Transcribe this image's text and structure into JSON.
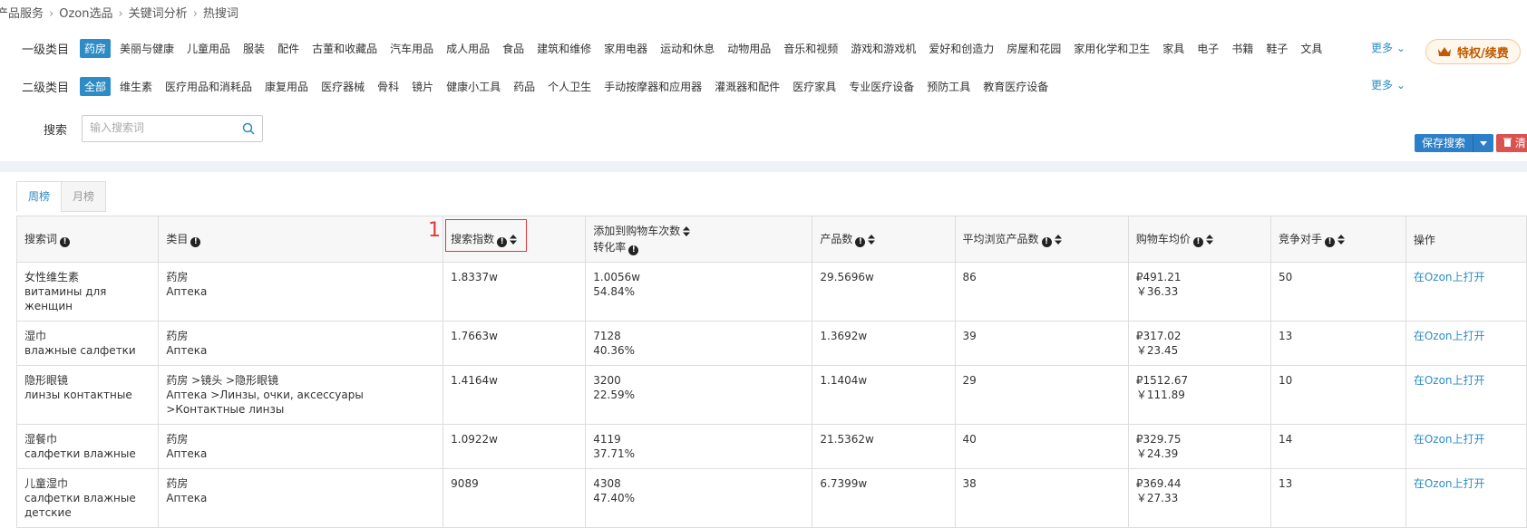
{
  "breadcrumb": {
    "items": [
      "产品服务",
      "Ozon选品",
      "关键词分析",
      "热搜词"
    ]
  },
  "level1": {
    "label": "一级类目",
    "items": [
      "药房",
      "美丽与健康",
      "儿童用品",
      "服装",
      "配件",
      "古董和收藏品",
      "汽车用品",
      "成人用品",
      "食品",
      "建筑和维修",
      "家用电器",
      "运动和休息",
      "动物用品",
      "音乐和视频",
      "游戏和游戏机",
      "爱好和创造力",
      "房屋和花园",
      "家用化学和卫生",
      "家具",
      "电子",
      "书籍",
      "鞋子",
      "文具"
    ],
    "active_index": 0,
    "more": "更多"
  },
  "level2": {
    "label": "二级类目",
    "items": [
      "全部",
      "维生素",
      "医疗用品和消耗品",
      "康复用品",
      "医疗器械",
      "骨科",
      "镜片",
      "健康小工具",
      "药品",
      "个人卫生",
      "手动按摩器和应用器",
      "灌溉器和配件",
      "医疗家具",
      "专业医疗设备",
      "预防工具",
      "教育医疗设备"
    ],
    "active_index": 0,
    "more": "更多"
  },
  "vip_button": "特权/续费",
  "search": {
    "label": "搜索",
    "placeholder": "输入搜索词"
  },
  "save_search": "保存搜索",
  "clear_label": "清",
  "tabs": [
    "周榜",
    "月榜"
  ],
  "annotation_number": "1",
  "table": {
    "headers": {
      "keyword": "搜索词",
      "category": "类目",
      "search_index": "搜索指数",
      "cart_adds": "添加到购物车次数",
      "conversion": "转化率",
      "products": "产品数",
      "avg_views": "平均浏览产品数",
      "cart_price": "购物车均价",
      "competitors": "竞争对手",
      "action": "操作"
    },
    "rows": [
      {
        "kw_cn": "女性维生素",
        "kw_ru": "витамины для женщин",
        "cat_cn": "药房",
        "cat_ru": "Аптека",
        "search_index": "1.8337w",
        "cart_adds": "1.0056w",
        "conversion": "54.84%",
        "products": "29.5696w",
        "avg_views": "86",
        "price_rub": "₽491.21",
        "price_cny": "￥36.33",
        "competitors": "50",
        "action": "在Ozon上打开"
      },
      {
        "kw_cn": "湿巾",
        "kw_ru": "влажные салфетки",
        "cat_cn": "药房",
        "cat_ru": "Аптека",
        "search_index": "1.7663w",
        "cart_adds": "7128",
        "conversion": "40.36%",
        "products": "1.3692w",
        "avg_views": "39",
        "price_rub": "₽317.02",
        "price_cny": "￥23.45",
        "competitors": "13",
        "action": "在Ozon上打开"
      },
      {
        "kw_cn": "隐形眼镜",
        "kw_ru": "линзы контактные",
        "cat_cn": "药房 >镜头 >隐形眼镜",
        "cat_ru": "Аптека >Линзы, очки, аксессуары >Контактные линзы",
        "search_index": "1.4164w",
        "cart_adds": "3200",
        "conversion": "22.59%",
        "products": "1.1404w",
        "avg_views": "29",
        "price_rub": "₽1512.67",
        "price_cny": "￥111.89",
        "competitors": "10",
        "action": "在Ozon上打开"
      },
      {
        "kw_cn": "湿餐巾",
        "kw_ru": "салфетки влажные",
        "cat_cn": "药房",
        "cat_ru": "Аптека",
        "search_index": "1.0922w",
        "cart_adds": "4119",
        "conversion": "37.71%",
        "products": "21.5362w",
        "avg_views": "40",
        "price_rub": "₽329.75",
        "price_cny": "￥24.39",
        "competitors": "14",
        "action": "在Ozon上打开"
      },
      {
        "kw_cn": "儿童湿巾",
        "kw_ru": "салфетки влажные детские",
        "cat_cn": "药房",
        "cat_ru": "Аптека",
        "search_index": "9089",
        "cart_adds": "4308",
        "conversion": "47.40%",
        "products": "6.7399w",
        "avg_views": "38",
        "price_rub": "₽369.44",
        "price_cny": "￥27.33",
        "competitors": "13",
        "action": "在Ozon上打开"
      }
    ]
  }
}
